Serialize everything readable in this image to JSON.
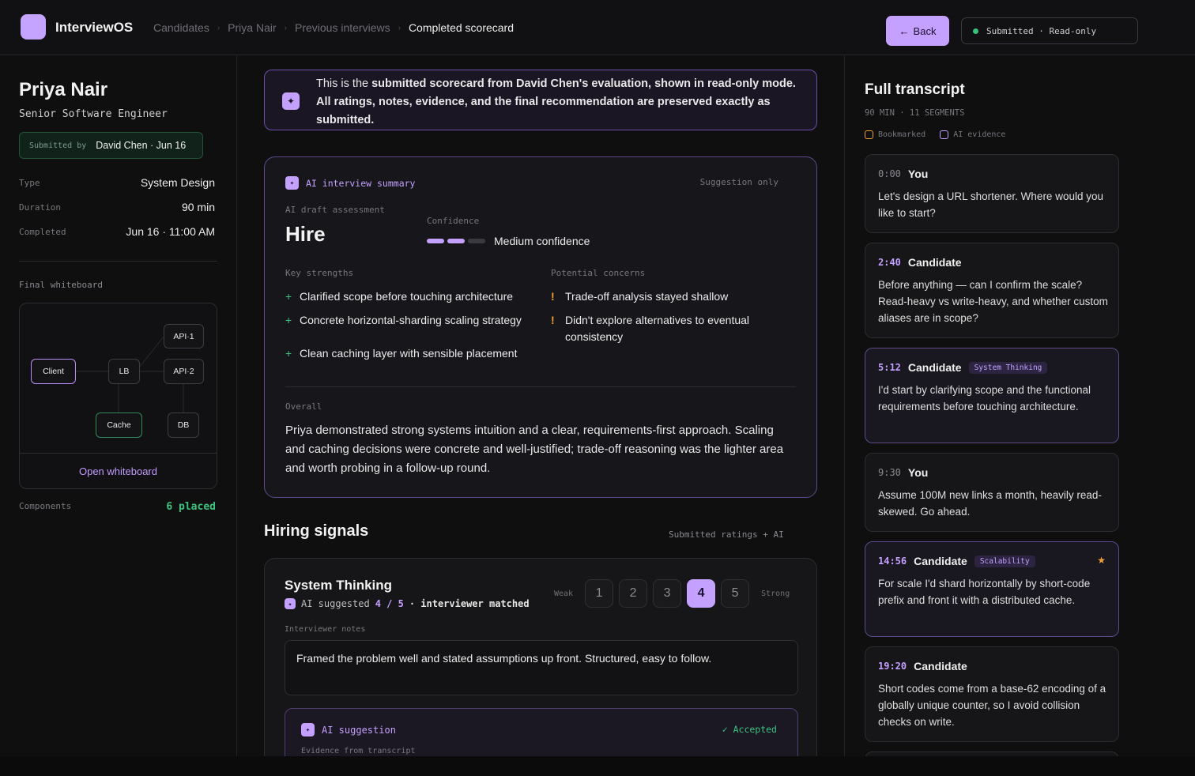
{
  "app": {
    "name": "InterviewOS"
  },
  "breadcrumb": [
    "Candidates",
    "Priya Nair",
    "Previous interviews",
    "Completed scorecard"
  ],
  "header": {
    "back_label": "Back",
    "status": "Submitted · Read-only"
  },
  "candidate": {
    "name": "Priya Nair",
    "role": "Senior Software Engineer",
    "submitted_by_label": "Submitted by",
    "submitted_by": "David Chen · Jun 16",
    "meta": [
      {
        "label": "Type",
        "value": "System Design"
      },
      {
        "label": "Duration",
        "value": "90 min"
      },
      {
        "label": "Completed",
        "value": "Jun 16 · 11:00 AM"
      }
    ],
    "whiteboard_label": "Final whiteboard",
    "whiteboard_nodes": [
      "API·1",
      "Client",
      "LB",
      "API·2",
      "Cache",
      "DB"
    ],
    "open_whiteboard": "Open whiteboard",
    "components_label": "Components",
    "components_value": "6 placed"
  },
  "banner": {
    "prefix": "This is the ",
    "bold": "submitted scorecard from David Chen's evaluation, shown in read-only mode. All ratings, notes, evidence, and the final recommendation are preserved exactly as submitted."
  },
  "ai_summary": {
    "title": "AI interview summary",
    "suggestion_label": "Suggestion only",
    "draft_label": "AI draft assessment",
    "recommendation": "Hire",
    "confidence_label": "Confidence",
    "confidence_level": 2,
    "confidence_max": 3,
    "confidence_text": "Medium confidence",
    "strengths_label": "Key strengths",
    "strengths": [
      "Clarified scope before touching architecture",
      "Concrete horizontal-sharding scaling strategy",
      "Clean caching layer with sensible placement"
    ],
    "concerns_label": "Potential concerns",
    "concerns": [
      "Trade-off analysis stayed shallow",
      "Didn't explore alternatives to eventual consistency"
    ],
    "overall_label": "Overall",
    "overall": "Priya demonstrated strong systems intuition and a clear, requirements-first approach. Scaling and caching decisions were concrete and well-justified; trade-off reasoning was the lighter area and worth probing in a follow-up round."
  },
  "signals": {
    "title": "Hiring signals",
    "subtitle": "Submitted ratings + AI",
    "card": {
      "title": "System Thinking",
      "ai_prefix": "AI suggested",
      "ai_value": "4 / 5",
      "ai_suffix": "· interviewer matched",
      "weak": "Weak",
      "strong": "Strong",
      "scale": [
        "1",
        "2",
        "3",
        "4",
        "5"
      ],
      "selected": 4,
      "notes_label": "Interviewer notes",
      "notes": "Framed the problem well and stated assumptions up front. Structured, easy to follow.",
      "ai_suggestion_label": "AI suggestion",
      "accepted": "✓ Accepted",
      "evidence_label": "Evidence from transcript"
    }
  },
  "transcript": {
    "title": "Full transcript",
    "subtitle": "90 MIN · 11 SEGMENTS",
    "legend_bookmarked": "Bookmarked",
    "legend_ai": "AI evidence",
    "segments": [
      {
        "time": "0:00",
        "speaker": "You",
        "tag": "",
        "text": "Let's design a URL shortener. Where would you like to start?"
      },
      {
        "time": "2:40",
        "speaker": "Candidate",
        "tag": "",
        "text": "Before anything — can I confirm the scale? Read-heavy vs write-heavy, and whether custom aliases are in scope?"
      },
      {
        "time": "5:12",
        "speaker": "Candidate",
        "tag": "System Thinking",
        "text": "I'd start by clarifying scope and the functional requirements before touching architecture."
      },
      {
        "time": "9:30",
        "speaker": "You",
        "tag": "",
        "text": "Assume 100M new links a month, heavily read-skewed. Go ahead."
      },
      {
        "time": "14:56",
        "speaker": "Candidate",
        "tag": "Scalability",
        "text": "For scale I'd shard horizontally by short-code prefix and front it with a distributed cache."
      },
      {
        "time": "19:20",
        "speaker": "Candidate",
        "tag": "",
        "text": "Short codes come from a base-62 encoding of a globally unique counter, so I avoid collision checks on write."
      }
    ]
  },
  "colors": {
    "accent": "#c4a0ff",
    "success": "#3cc47f",
    "warning": "#f0a030",
    "background": "#0f0f10"
  },
  "icons": [
    "sparkle-icon",
    "arrow-left-icon",
    "status-dot-icon",
    "star-icon",
    "plus-icon",
    "exclamation-icon",
    "check-icon"
  ]
}
